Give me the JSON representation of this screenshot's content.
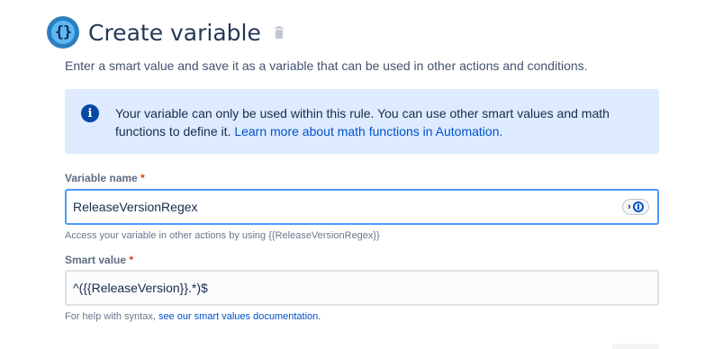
{
  "header": {
    "title": "Create variable",
    "icon": "braces-icon",
    "icon_glyph": "{}",
    "delete_icon": "trash-icon"
  },
  "description": "Enter a smart value and save it as a variable that can be used in other actions and conditions.",
  "info": {
    "icon": "info-icon",
    "text": "Your variable can only be used within this rule. You can use other smart values and math functions to define it. ",
    "link": "Learn more about math functions in Automation."
  },
  "variable_name": {
    "label": "Variable name",
    "required_mark": "*",
    "value": "ReleaseVersionRegex",
    "helper": "Access your variable in other actions by using {{ReleaseVersionRegex}}"
  },
  "smart_value": {
    "label": "Smart value",
    "required_mark": "*",
    "value": "^({{ReleaseVersion}}.*)$",
    "helper_prefix": "For help with syntax, ",
    "helper_link": "see our smart values documentation."
  },
  "colors": {
    "accent": "#0052cc",
    "info_bg": "#deebff",
    "required": "#de350b",
    "focus_border": "#4c9aff"
  }
}
